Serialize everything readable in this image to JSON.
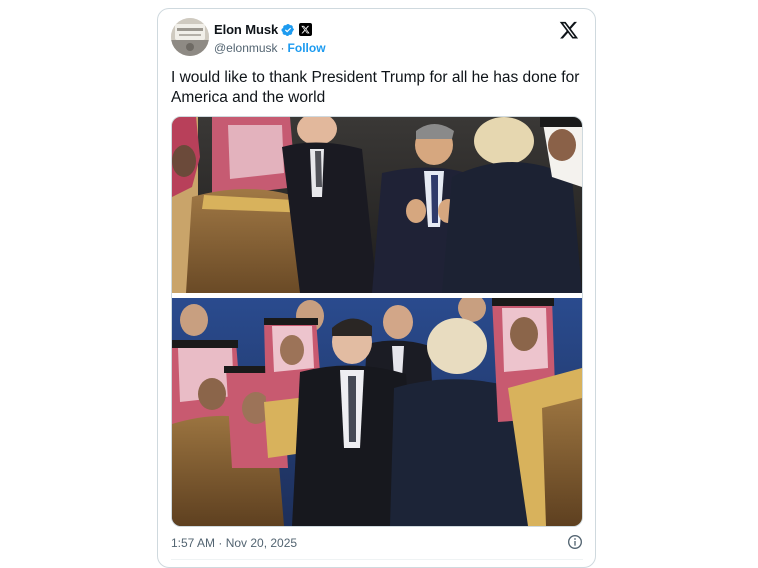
{
  "author": {
    "display_name": "Elon Musk",
    "handle": "@elonmusk",
    "separator": "·",
    "follow_label": "Follow",
    "verified_icon": "verified-badge-icon",
    "affiliate_icon": "x-affiliate-badge-icon"
  },
  "tweet": {
    "text": "I would like to thank President Trump for all he has done for America and the world",
    "timestamp": "1:57 AM · Nov 20, 2025"
  },
  "media": {
    "photos": [
      "photo-top",
      "photo-bottom"
    ]
  },
  "colors": {
    "accent": "#1d9bf0",
    "text_primary": "#0f1419",
    "text_secondary": "#536471",
    "border": "#cfd9de"
  },
  "icons": {
    "brand": "x-logo-icon",
    "info": "info-icon"
  }
}
